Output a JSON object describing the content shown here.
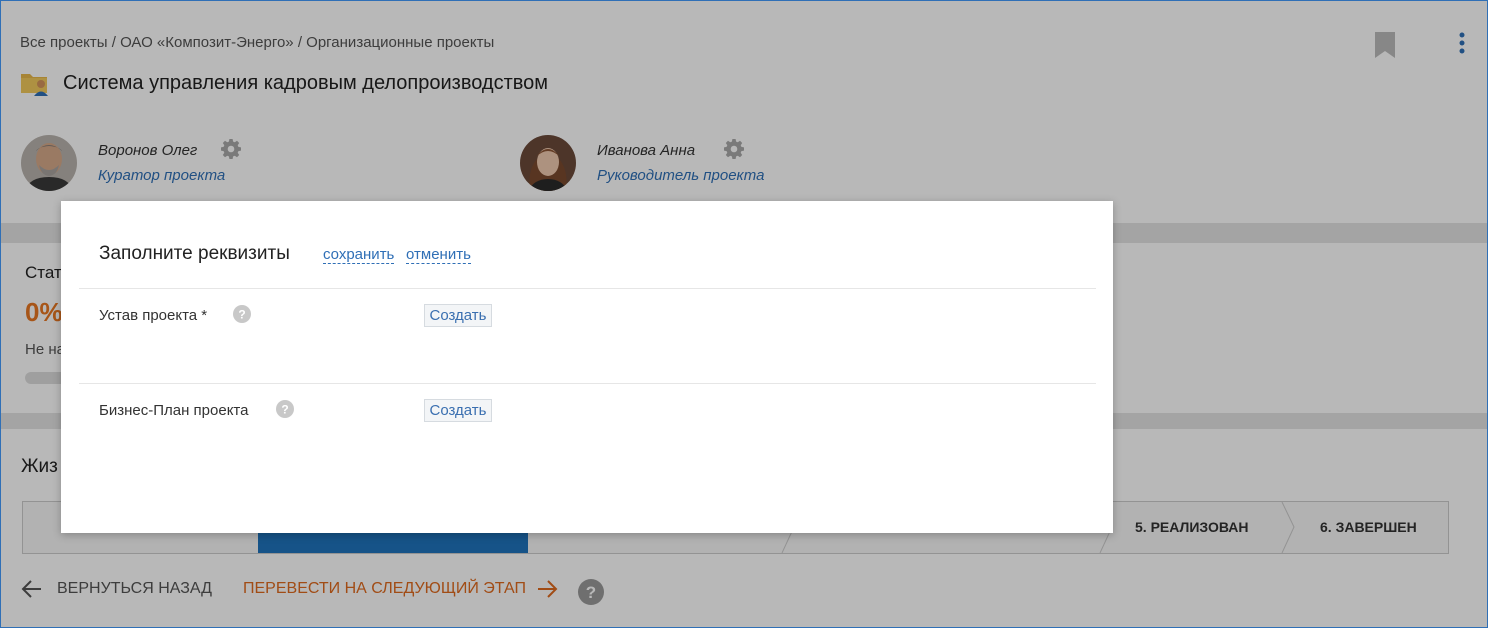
{
  "breadcrumb": {
    "items": [
      "Все проекты",
      "ОАО «Композит-Энерго»",
      "Организационные проекты"
    ],
    "separator": "/"
  },
  "project": {
    "title": "Система управления кадровым делопроизводством",
    "icon": "folder-user-icon"
  },
  "people": [
    {
      "name": "Воронов Олег",
      "role": "Куратор проекта"
    },
    {
      "name": "Иванова Анна",
      "role": "Руководитель проекта"
    }
  ],
  "status": {
    "label": "Стат",
    "percent": "0%",
    "progress_fraction": 0,
    "text": "Не на"
  },
  "lifecycle": {
    "label": "Жиз",
    "stages": [
      {
        "label": "5. РЕАЛИЗОВАН"
      },
      {
        "label": "6. ЗАВЕРШЕН"
      }
    ]
  },
  "actions": {
    "back": "ВЕРНУТЬСЯ НАЗАД",
    "next": "ПЕРЕВЕСТИ НА СЛЕДУЮЩИЙ ЭТАП"
  },
  "modal": {
    "title": "Заполните реквизиты",
    "save": "сохранить",
    "cancel": "отменить",
    "fields": [
      {
        "label": "Устав проекта *",
        "button": "Создать"
      },
      {
        "label": "Бизнес-План проекта",
        "button": "Создать"
      }
    ]
  },
  "colors": {
    "accent_blue": "#2f6fb6",
    "accent_orange": "#e87722",
    "stage_active": "#1f73bd"
  }
}
